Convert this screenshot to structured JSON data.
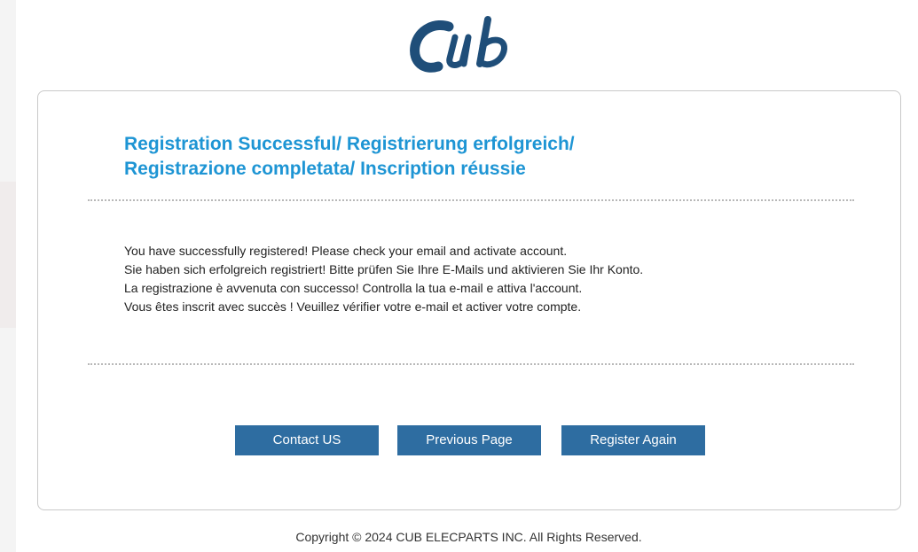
{
  "brand": {
    "logo_text": "Cub",
    "logo_color": "#1f4e79"
  },
  "title": {
    "line1": "Registration Successful/ Registrierung erfolgreich/",
    "line2": "Registrazione completata/ Inscription réussie",
    "color": "#1e95d4"
  },
  "message": {
    "lines": [
      "You have successfully registered! Please check your email and activate account.",
      "Sie haben sich erfolgreich registriert! Bitte prüfen Sie Ihre E-Mails und aktivieren Sie Ihr Konto.",
      "La registrazione è avvenuta con successo! Controlla la tua e-mail e attiva l'account.",
      "Vous êtes inscrit avec succès ! Veuillez vérifier votre e-mail et activer votre compte."
    ]
  },
  "buttons": {
    "contact_label": "Contact US",
    "previous_label": "Previous Page",
    "register_label": "Register Again",
    "color": "#2e6da1"
  },
  "footer": {
    "copyright": "Copyright © 2024 CUB ELECPARTS INC. All Rights Reserved."
  }
}
